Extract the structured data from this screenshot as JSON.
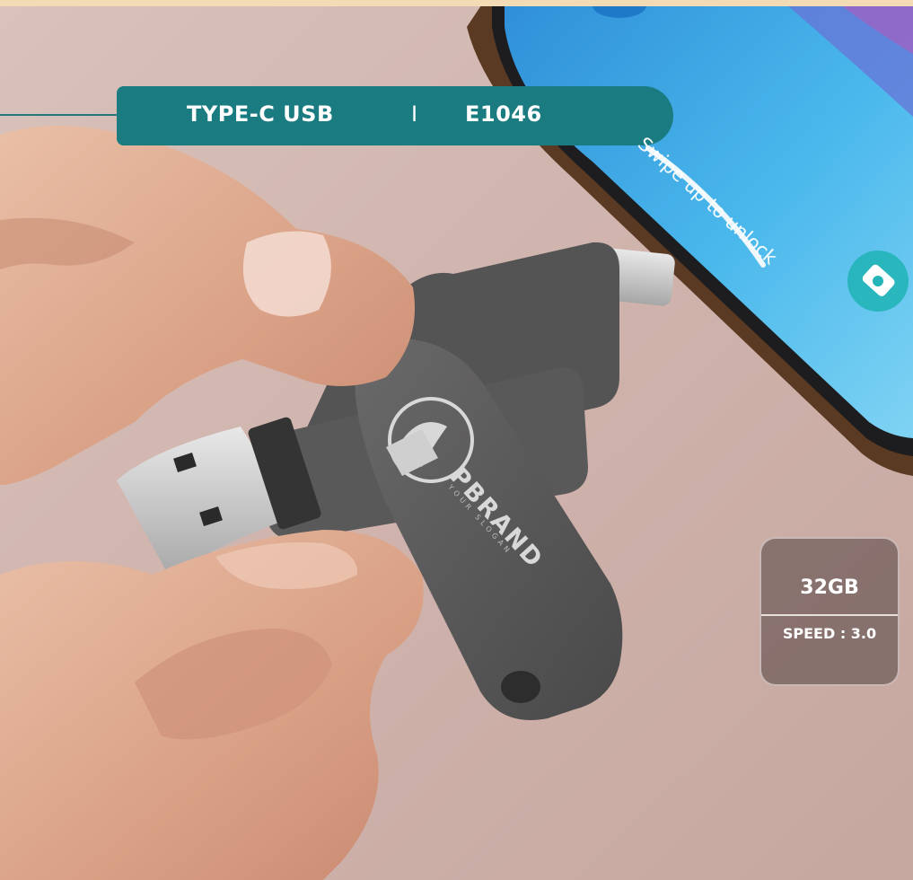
{
  "banner": {
    "product_type": "TYPE-C  USB",
    "separator": "I",
    "model_code": "E1046"
  },
  "phone": {
    "lock_screen_text": "Swipe up to unlock",
    "camera_icon": "camera-icon"
  },
  "drive": {
    "brand_name": "PBRAND",
    "brand_slogan": "YOUR SLOGAN"
  },
  "specs": {
    "capacity": "32GB",
    "speed": "SPEED : 3.0"
  },
  "colors": {
    "banner_teal": "#1a7b80",
    "card_fill": "#5f4e4c",
    "phone_screen": "#3fb0e6",
    "drive_metal": "#5b5a5b"
  }
}
